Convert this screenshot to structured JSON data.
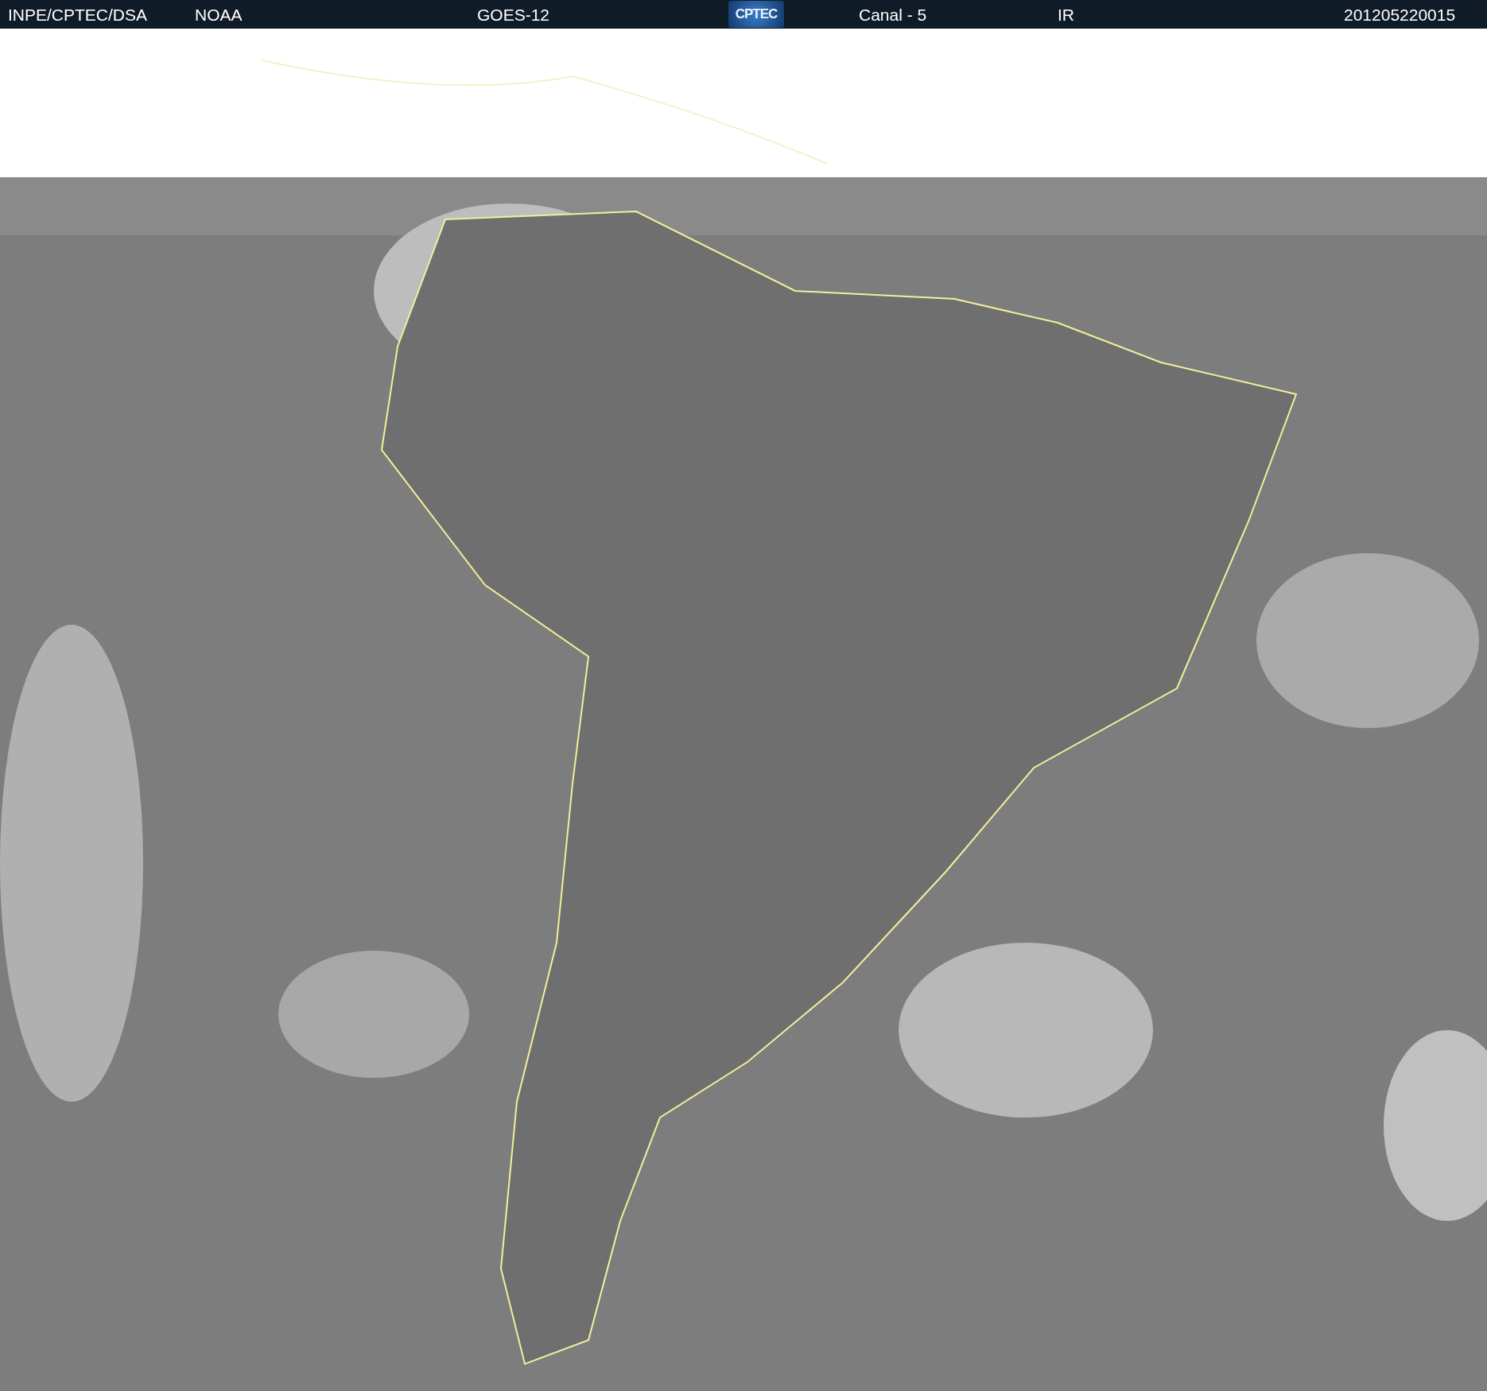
{
  "header": {
    "items": [
      {
        "kind": "text",
        "text": "INPE/CPTEC/DSA"
      },
      {
        "kind": "text",
        "text": "NOAA"
      },
      {
        "kind": "text",
        "text": "GOES-12"
      },
      {
        "kind": "logo",
        "text": "CPTEC"
      },
      {
        "kind": "text",
        "text": "Canal - 5"
      },
      {
        "kind": "text",
        "text": "IR"
      },
      {
        "kind": "text",
        "text": "201205220015"
      }
    ]
  }
}
